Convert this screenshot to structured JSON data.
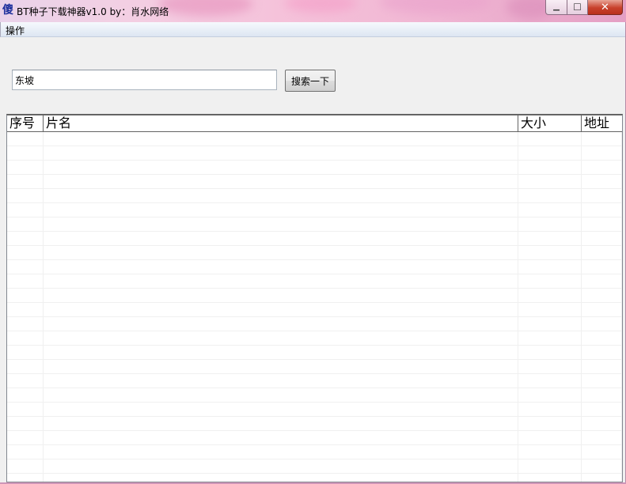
{
  "window": {
    "title": "BT种子下载神器v1.0  by：肖水网络",
    "icon": "app-icon",
    "icon_glyph": "傻",
    "controls": {
      "minimize_icon": "minimize-icon",
      "maximize_icon": "maximize-icon",
      "close_icon": "close-icon",
      "minimize_glyph": "▁",
      "maximize_glyph": "☐",
      "close_glyph": "✕"
    }
  },
  "menubar": {
    "items": [
      {
        "label": "操作"
      }
    ]
  },
  "search": {
    "value": "东坡",
    "button_label": "搜索一下"
  },
  "results": {
    "columns": [
      {
        "label": "序号"
      },
      {
        "label": "片名"
      },
      {
        "label": "大小"
      },
      {
        "label": "地址"
      }
    ],
    "rows": []
  },
  "colors": {
    "titlebar_accent": "#f0b6d3",
    "close_button": "#c8412c",
    "window_background": "#f0f0f0",
    "list_background": "#ffffff"
  }
}
